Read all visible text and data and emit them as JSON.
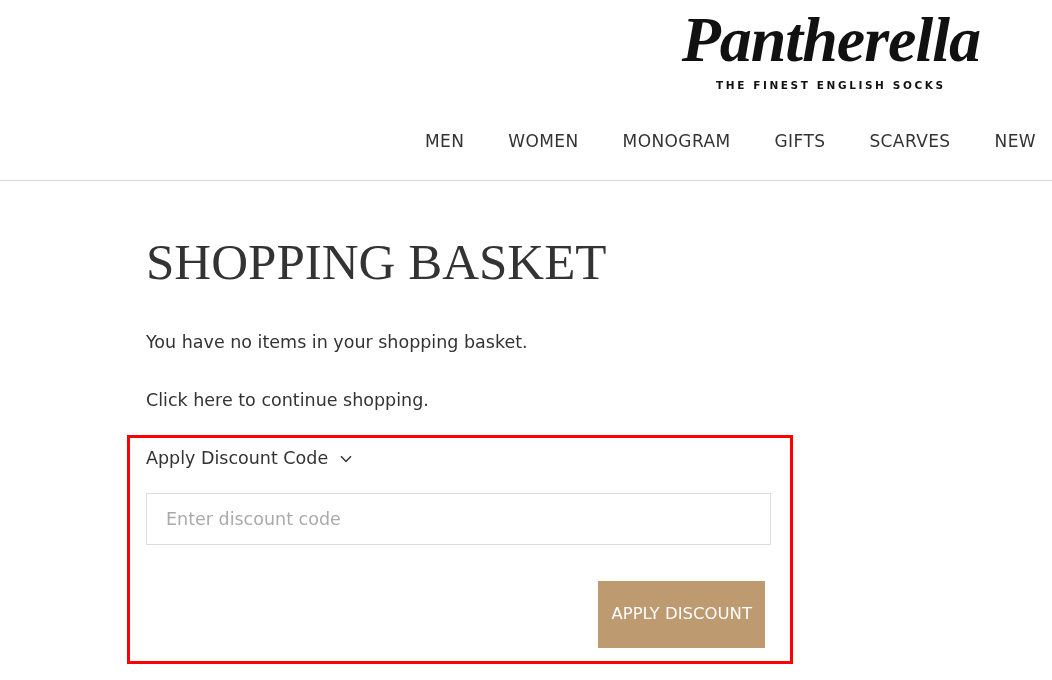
{
  "header": {
    "logo": "Pantherella",
    "tagline": "THE FINEST ENGLISH SOCKS",
    "nav": [
      "MEN",
      "WOMEN",
      "MONOGRAM",
      "GIFTS",
      "SCARVES",
      "NEW"
    ]
  },
  "page": {
    "title": "SHOPPING BASKET",
    "messages": [
      "You have no items in your shopping basket.",
      "Click here to continue shopping."
    ]
  },
  "discount": {
    "highlighted": true,
    "label": "Apply Discount Code",
    "expanded": true,
    "placeholder": "Enter discount code",
    "button": "APPLY DISCOUNT"
  }
}
